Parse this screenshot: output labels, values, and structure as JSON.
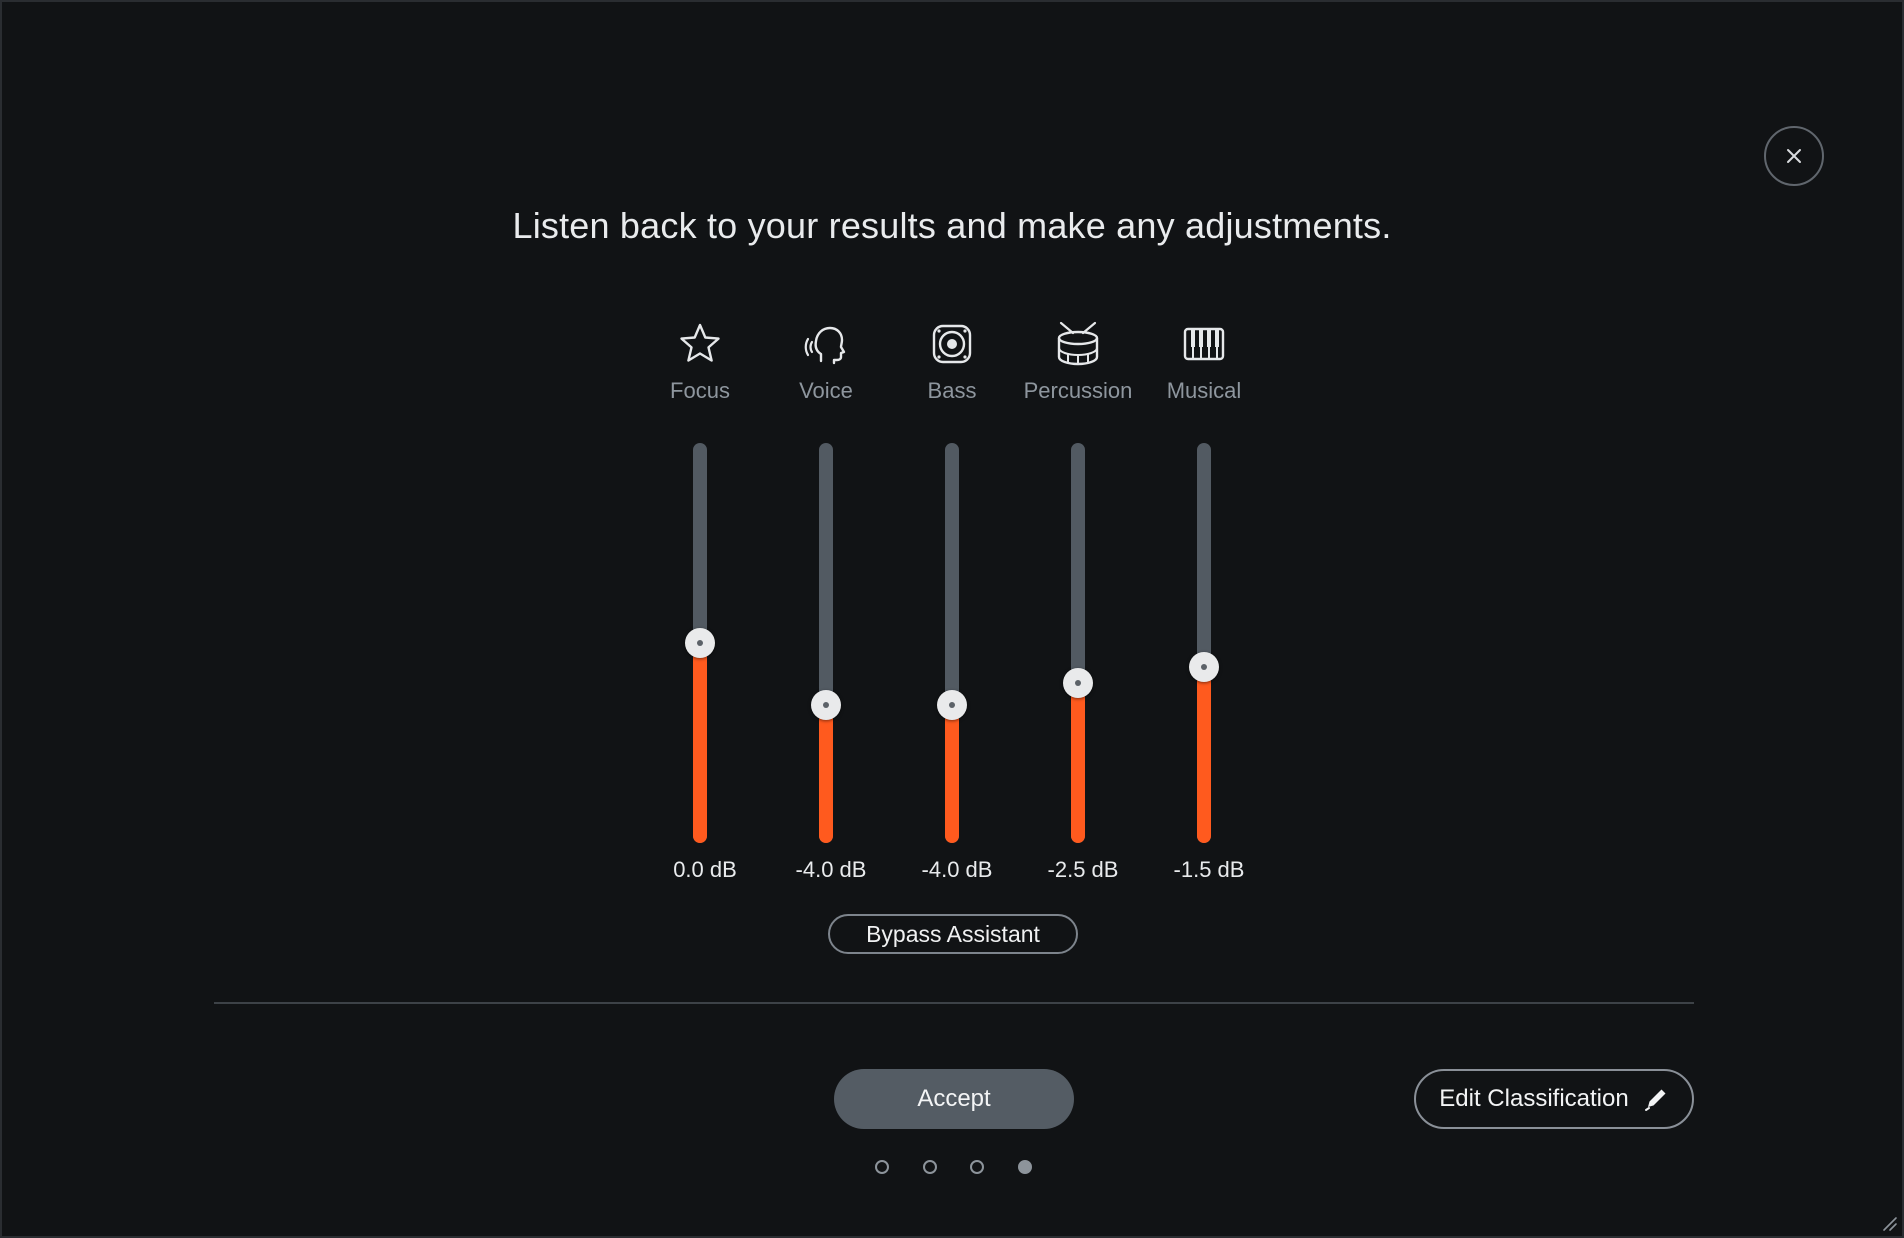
{
  "dialog": {
    "title": "Listen back to your results and make any adjustments."
  },
  "channels": [
    {
      "label": "Focus",
      "icon": "star-icon",
      "value": "0.0 dB",
      "level": 0.5
    },
    {
      "label": "Voice",
      "icon": "voice-icon",
      "value": "-4.0 dB",
      "level": 0.345
    },
    {
      "label": "Bass",
      "icon": "speaker-icon",
      "value": "-4.0 dB",
      "level": 0.345
    },
    {
      "label": "Percussion",
      "icon": "drum-icon",
      "value": "-2.5 dB",
      "level": 0.4
    },
    {
      "label": "Musical",
      "icon": "piano-icon",
      "value": "-1.5 dB",
      "level": 0.44
    }
  ],
  "bypass": {
    "label": "Bypass Assistant"
  },
  "footer": {
    "accept_label": "Accept",
    "edit_label": "Edit Classification"
  },
  "pager": {
    "total": 4,
    "current": 4
  },
  "colors": {
    "background": "#111315",
    "accent": "#ff5a1e",
    "track": "#525a62",
    "accept_button": "#545c64"
  }
}
